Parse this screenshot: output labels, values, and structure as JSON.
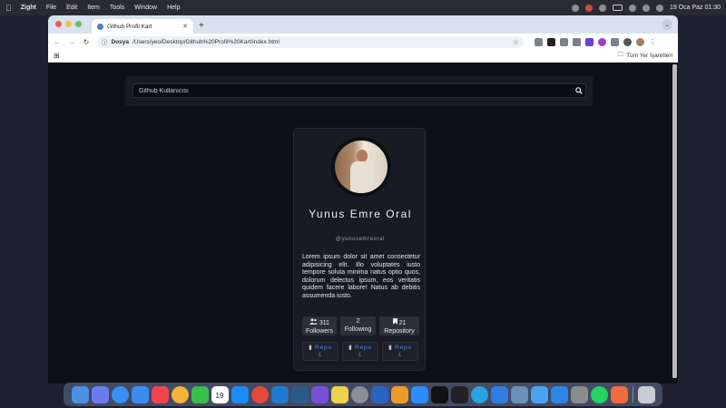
{
  "menubar": {
    "app": "Zight",
    "items": [
      "File",
      "Edit",
      "Item",
      "Tools",
      "Window",
      "Help"
    ],
    "datetime": "19 Oca Paz  01:30"
  },
  "browser": {
    "tab_title": "Github Profil Kart",
    "security_chip": "Dosya",
    "url": "/Users/yeo/Desktop/Github%20Profil%20Kart/index.html",
    "bookmarks_all": "Tüm Yer İşaretleri"
  },
  "search": {
    "placeholder": "Github Kullanıcısı"
  },
  "profile": {
    "name": "Yunus Emre Oral",
    "username": "@yunusemreoral",
    "bio": "Lorem ipsum dolor sit amet consectetur adipisicing elit. Illo voluptates iusto tempore soluta minima natus optio quos, dolorum delectus ipsum, eos veritatis quidem facere labore! Natus ab debitis assumenda iusto.",
    "stats": [
      {
        "value": "311",
        "label": "Followers",
        "icon": "users-icon"
      },
      {
        "value": "2",
        "label": "Following",
        "icon": ""
      },
      {
        "value": "21",
        "label": "Repository",
        "icon": "bookmark-icon"
      }
    ],
    "repos": [
      {
        "label": "Repo",
        "num": "1"
      },
      {
        "label": "Repo",
        "num": "1"
      },
      {
        "label": "Repo",
        "num": "1"
      }
    ]
  },
  "dock": {
    "calendar_day": "19"
  }
}
